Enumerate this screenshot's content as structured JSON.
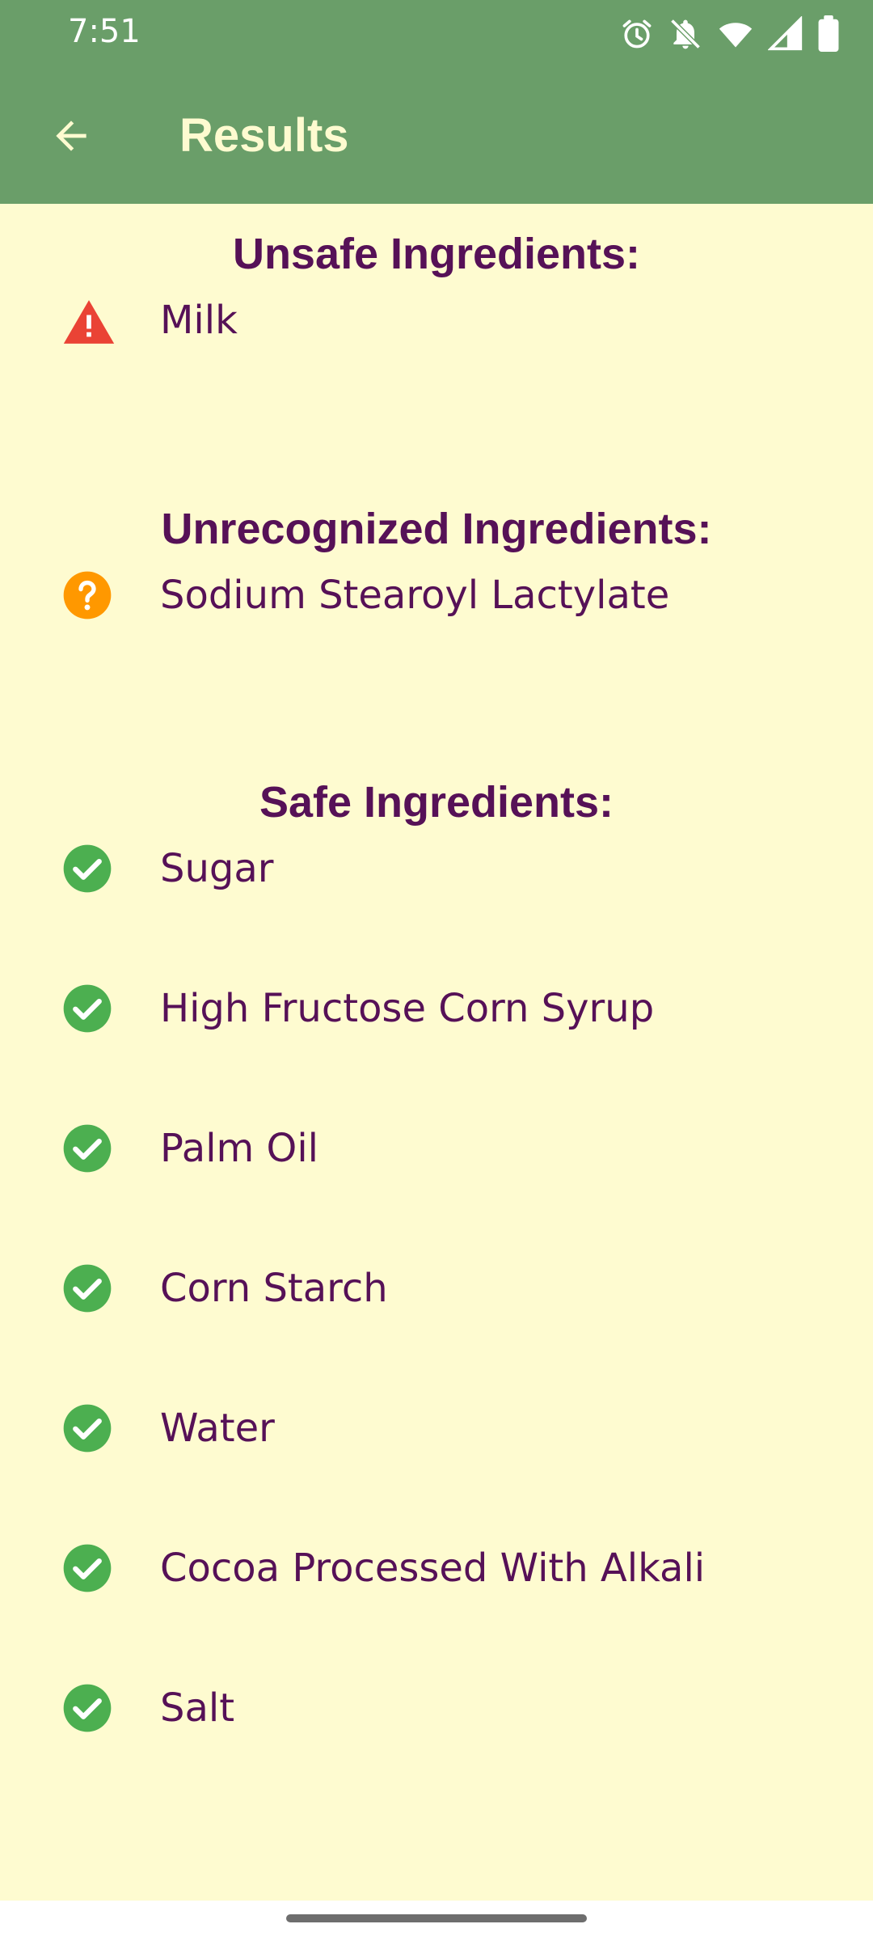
{
  "status_bar": {
    "time": "7:51",
    "icons": [
      "alarm-icon",
      "notifications-off-icon",
      "wifi-icon",
      "cell-signal-icon",
      "battery-icon"
    ]
  },
  "app_bar": {
    "title": "Results",
    "back_icon": "arrow-back-icon"
  },
  "colors": {
    "primary": "#6A9E69",
    "background": "#FEFBD0",
    "text": "#561157",
    "unsafe": "#EA4335",
    "unrecognized": "#FF9800",
    "safe": "#4CAF50"
  },
  "sections": {
    "unsafe": {
      "title": "Unsafe Ingredients:",
      "icon": "warning-icon",
      "items": [
        "Milk"
      ]
    },
    "unrecognized": {
      "title": "Unrecognized Ingredients:",
      "icon": "help-icon",
      "items": [
        "Sodium Stearoyl Lactylate"
      ]
    },
    "safe": {
      "title": "Safe Ingredients:",
      "icon": "check-circle-icon",
      "items": [
        "Sugar",
        "High Fructose Corn Syrup",
        "Palm Oil",
        "Corn Starch",
        "Water",
        "Cocoa Processed With Alkali",
        "Salt"
      ]
    }
  }
}
